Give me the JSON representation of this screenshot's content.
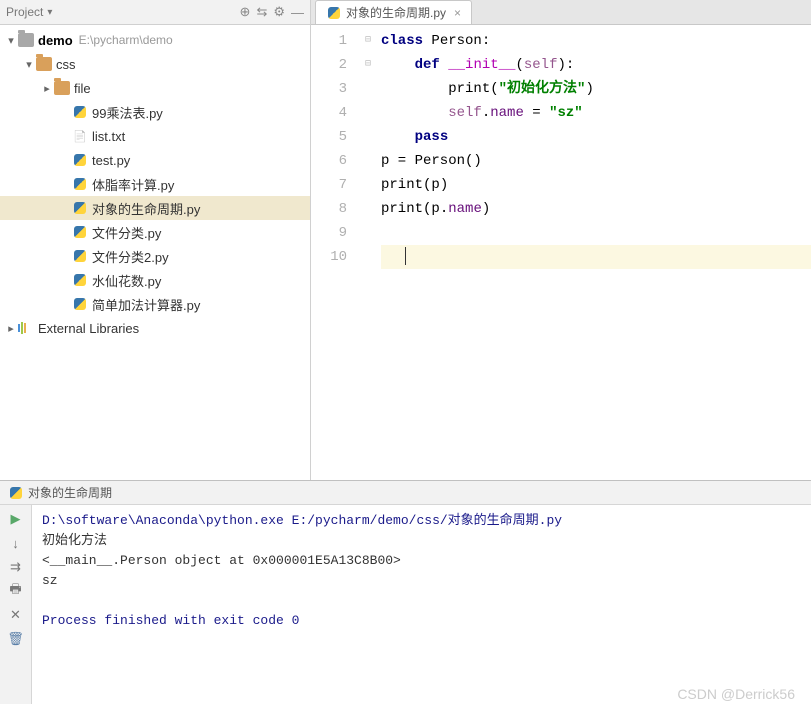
{
  "sidebar": {
    "title": "Project",
    "root": {
      "name": "demo",
      "path": "E:\\pycharm\\demo"
    },
    "css": "css",
    "file_folder": "file",
    "files": [
      "99乘法表.py",
      "list.txt",
      "test.py",
      "体脂率计算.py",
      "对象的生命周期.py",
      "文件分类.py",
      "文件分类2.py",
      "水仙花数.py",
      "简单加法计算器.py"
    ],
    "external": "External Libraries"
  },
  "tab": {
    "label": "对象的生命周期.py",
    "close": "×"
  },
  "code": {
    "l1": {
      "kw1": "class",
      "name": " Person:"
    },
    "l2": {
      "kw1": "def",
      "fn": "__init__",
      "lp": "(",
      "self": "self",
      "rp": "):"
    },
    "l3": {
      "pr": "print(",
      "str": "\"初始化方法\"",
      "rp": ")"
    },
    "l4": {
      "self": "self",
      "dot": ".",
      "attr": "name",
      "eq": " = ",
      "str": "\"sz\""
    },
    "l5": {
      "kw": "pass"
    },
    "l6": "p = Person()",
    "l7": {
      "a": "print",
      "b": "(p)"
    },
    "l8": {
      "a": "print",
      "b": "(p.",
      "attr": "name",
      "c": ")"
    }
  },
  "gutter": [
    "1",
    "2",
    "3",
    "4",
    "5",
    "6",
    "7",
    "8",
    "9",
    "10"
  ],
  "run": {
    "tab": "对象的生命周期",
    "cmd": "D:\\software\\Anaconda\\python.exe E:/pycharm/demo/css/对象的生命周期.py",
    "out1": "初始化方法",
    "out2": "<__main__.Person object at 0x000001E5A13C8B00>",
    "out3": "sz",
    "exit": "Process finished with exit code 0"
  },
  "watermark": "CSDN @Derrick56"
}
